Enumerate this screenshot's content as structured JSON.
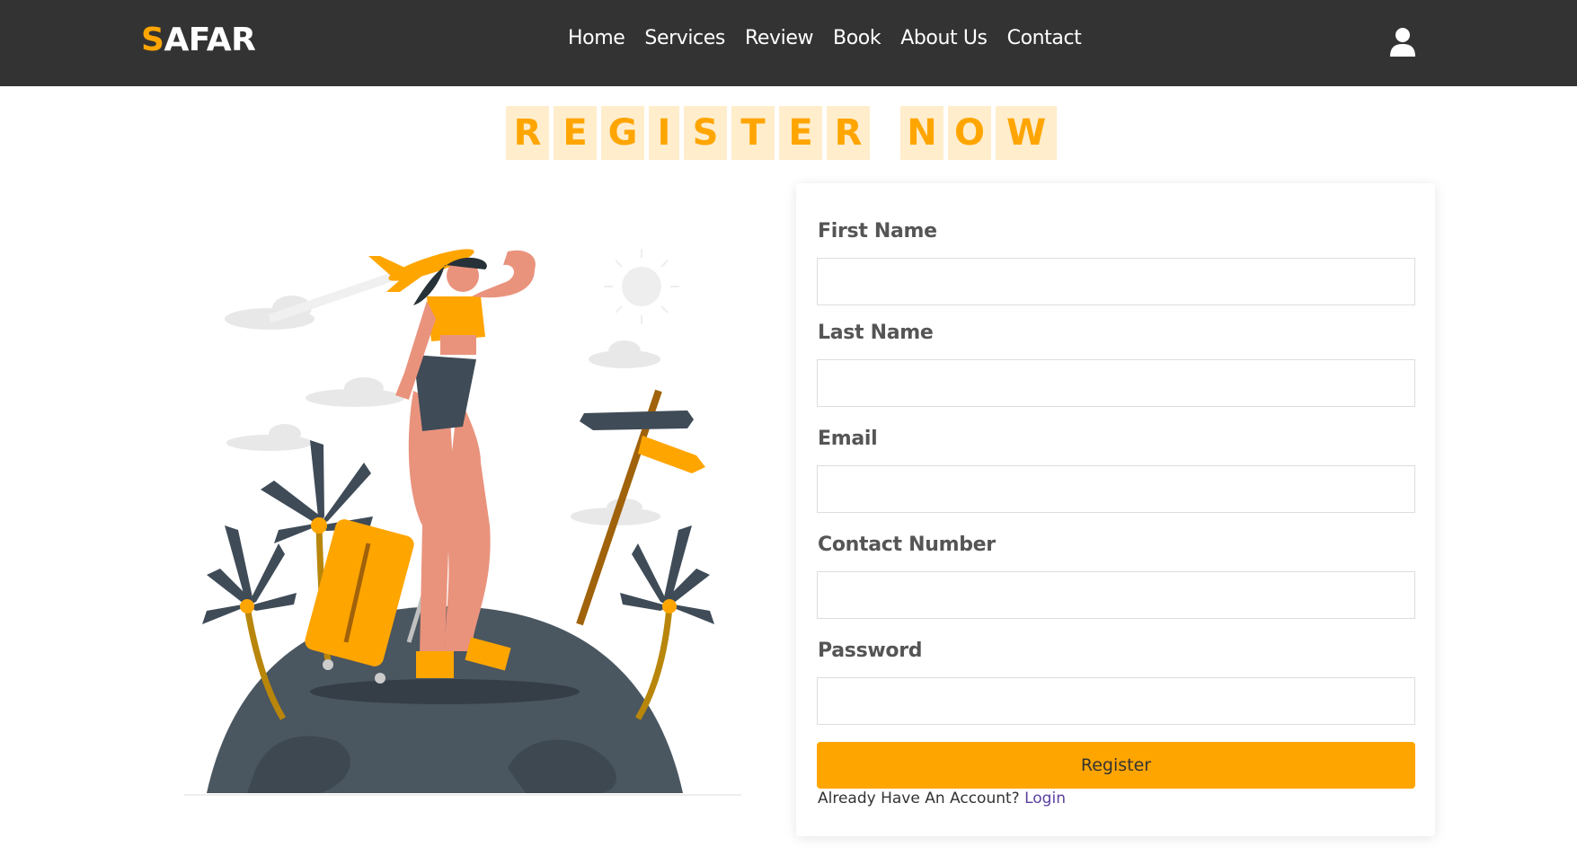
{
  "brand": {
    "first_letter": "S",
    "rest": "AFAR",
    "accent_color": "#ffa500"
  },
  "nav": {
    "links": [
      "Home",
      "Services",
      "Review",
      "Book",
      "About Us",
      "Contact"
    ],
    "user_icon": "user-icon"
  },
  "heading": {
    "letters": [
      "R",
      "E",
      "G",
      "I",
      "S",
      "T",
      "E",
      "R",
      " ",
      "N",
      "O",
      "W"
    ]
  },
  "illustration": {
    "description_icon": "traveler-illustration"
  },
  "form": {
    "fields": [
      {
        "label": "First Name",
        "value": "",
        "placeholder": ""
      },
      {
        "label": "Last Name",
        "value": "",
        "placeholder": ""
      },
      {
        "label": "Email",
        "value": "",
        "placeholder": ""
      },
      {
        "label": "Contact Number",
        "value": "",
        "placeholder": ""
      },
      {
        "label": "Password",
        "value": "",
        "placeholder": ""
      }
    ],
    "submit_label": "Register",
    "login_prompt": "Already Have An Account?",
    "login_link": "Login"
  },
  "colors": {
    "navbar": "#333333",
    "accent": "#ffa500",
    "letter_bg": "#ffedcc",
    "link": "#5a3fa0"
  }
}
